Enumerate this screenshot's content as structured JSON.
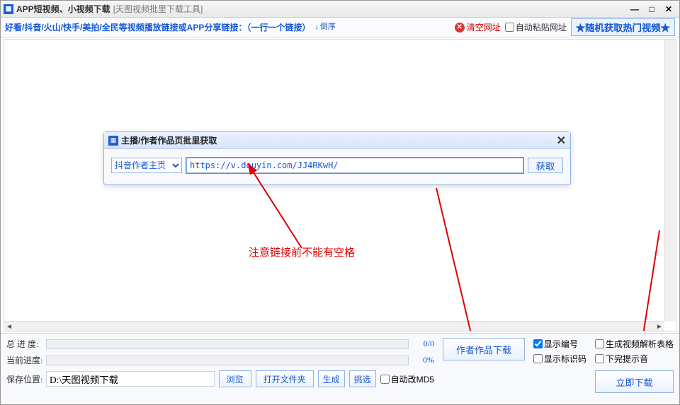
{
  "titlebar": {
    "title": "APP短视频、小视频下载",
    "subtitle": "[天图视频批里下载工具]"
  },
  "toolbar": {
    "hint": "好看/抖音/火山/快手/美拍/全民等视频播放链接或APP分享链接：（一行一个链接）",
    "sort_label": "倒序",
    "clear_label": "清空网址",
    "autopaste_label": "自动粘贴网址",
    "random_label": "★随机获取热门视频★"
  },
  "dialog": {
    "title": "主播/作者作品页批里获取",
    "select_value": "抖音作者主页",
    "url_value": "https://v.douyin.com/JJ4RKwH/",
    "get_label": "获取"
  },
  "annotation": {
    "text": "注意链接前不能有空格"
  },
  "bottom": {
    "total_progress_label": "总 进 度:",
    "current_progress_label": "当前进度:",
    "total_progress_text": "0/0",
    "current_progress_text": "0%",
    "save_path_label": "保存位置:",
    "save_path_value": "D:\\天图视频下载",
    "browse_label": "浏览",
    "open_folder_label": "打开文件夹",
    "author_works_label": "作者作品下载",
    "generate_label": "生成",
    "filter_label": "挑选",
    "show_number_label": "显示编号",
    "show_id_label": "显示标识码",
    "auto_md5_label": "自动改MD5",
    "gen_report_label": "生成视频解析表格",
    "download_hint_label": "下完提示音",
    "download_now_label": "立即下载"
  }
}
